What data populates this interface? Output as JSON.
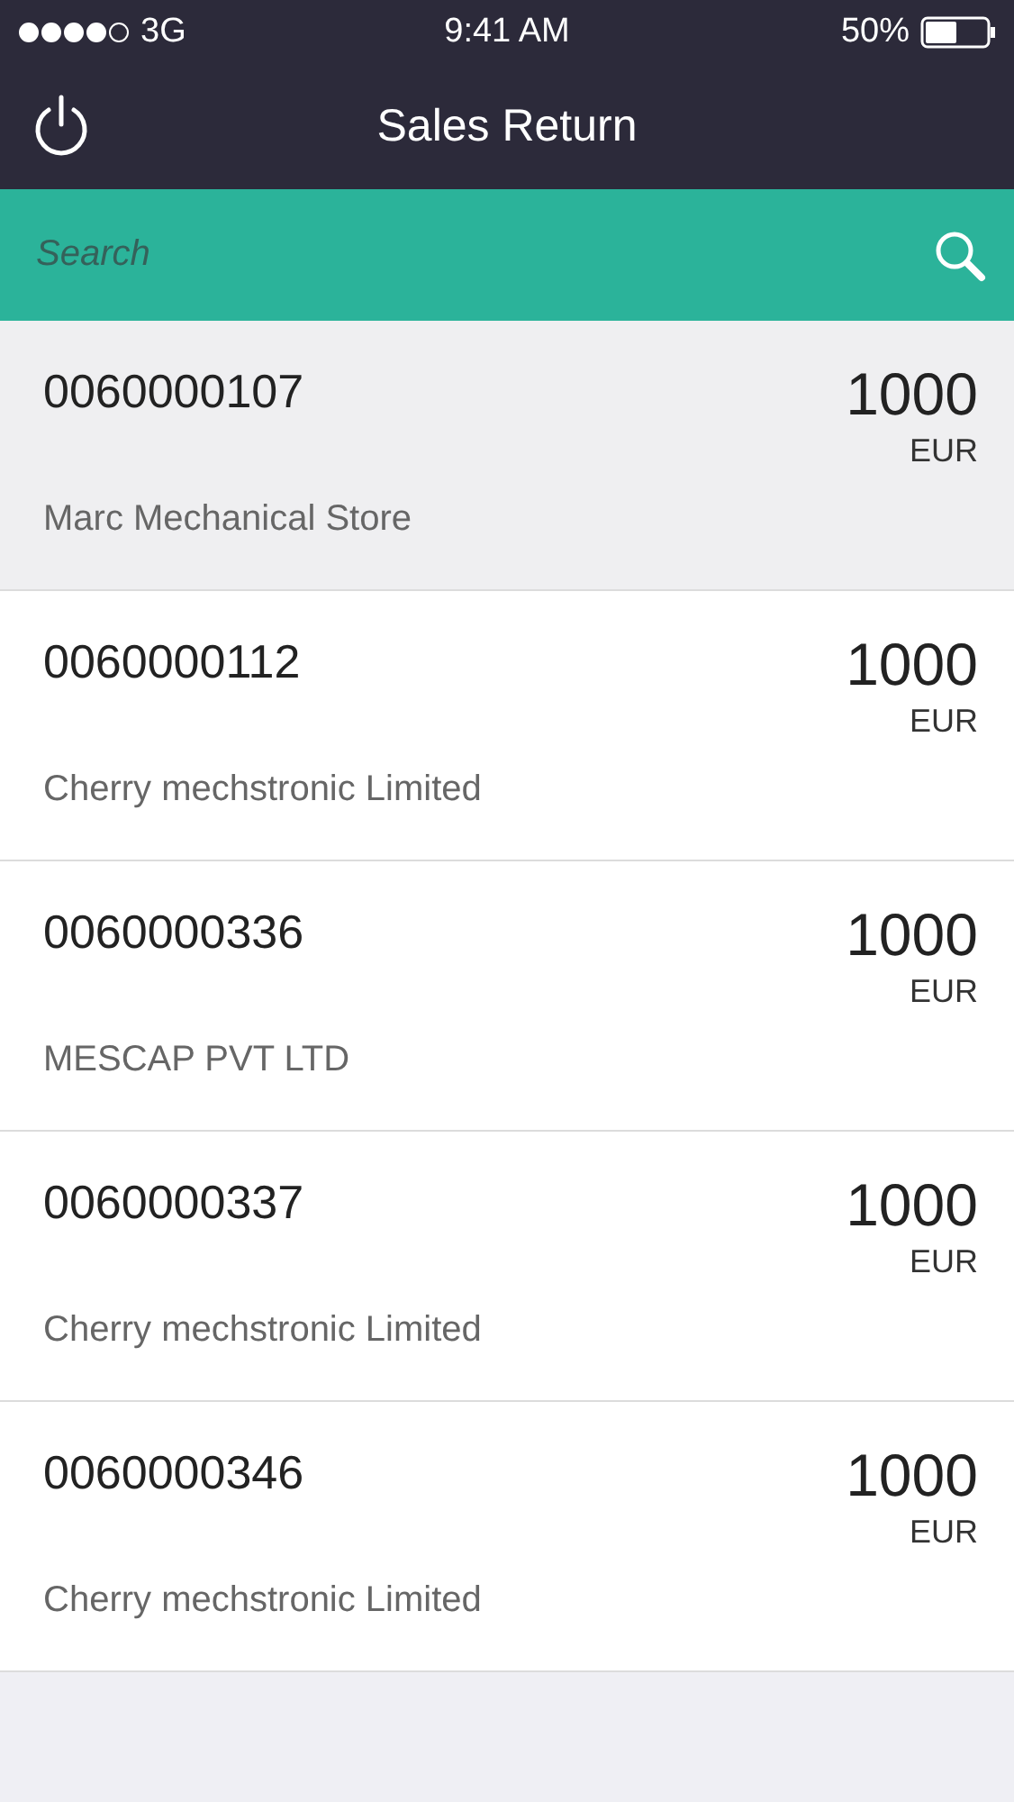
{
  "status_bar": {
    "carrier": "3G",
    "time": "9:41 AM",
    "battery": "50%"
  },
  "nav_bar": {
    "title": "Sales Return"
  },
  "search": {
    "placeholder": "Search"
  },
  "returns": [
    {
      "number": "0060000107",
      "amount": "1000",
      "currency": "EUR",
      "customer": "Marc Mechanical Store",
      "selected": true
    },
    {
      "number": "0060000112",
      "amount": "1000",
      "currency": "EUR",
      "customer": "Cherry mechstronic Limited",
      "selected": false
    },
    {
      "number": "0060000336",
      "amount": "1000",
      "currency": "EUR",
      "customer": "MESCAP PVT LTD",
      "selected": false
    },
    {
      "number": "0060000337",
      "amount": "1000",
      "currency": "EUR",
      "customer": "Cherry mechstronic Limited",
      "selected": false
    },
    {
      "number": "0060000346",
      "amount": "1000",
      "currency": "EUR",
      "customer": "Cherry mechstronic Limited",
      "selected": false
    }
  ]
}
